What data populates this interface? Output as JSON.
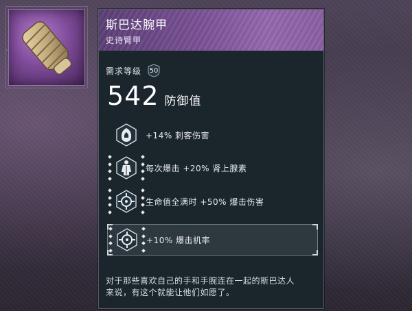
{
  "item": {
    "name": "斯巴达腕甲",
    "type": "史诗臂甲",
    "requirement_label": "需求等级",
    "requirement_level": "50",
    "defense_value": "542",
    "defense_label": "防御值",
    "description_line1": "对于那些喜欢自己的手和手腕连在一起的斯巴达人",
    "description_line2": "来说，有这个就能让他们如愿了。"
  },
  "perks": [
    {
      "icon": "assassin-hood-icon",
      "text": "+14% 刺客伤害",
      "engraving": false
    },
    {
      "icon": "adrenaline-figure-icon",
      "text": "每次爆击 +20% 肾上腺素",
      "engraving": true
    },
    {
      "icon": "crosshair-icon",
      "text": "生命值全满时 +50% 爆击伤害",
      "engraving": true
    },
    {
      "icon": "crosshair-icon",
      "text": "+10% 爆击机率",
      "engraving": true,
      "selected": true
    }
  ],
  "colors": {
    "panel_bg": "#1b262c",
    "header_purple": "#7a5195",
    "epic_purple": "#9468ad"
  }
}
